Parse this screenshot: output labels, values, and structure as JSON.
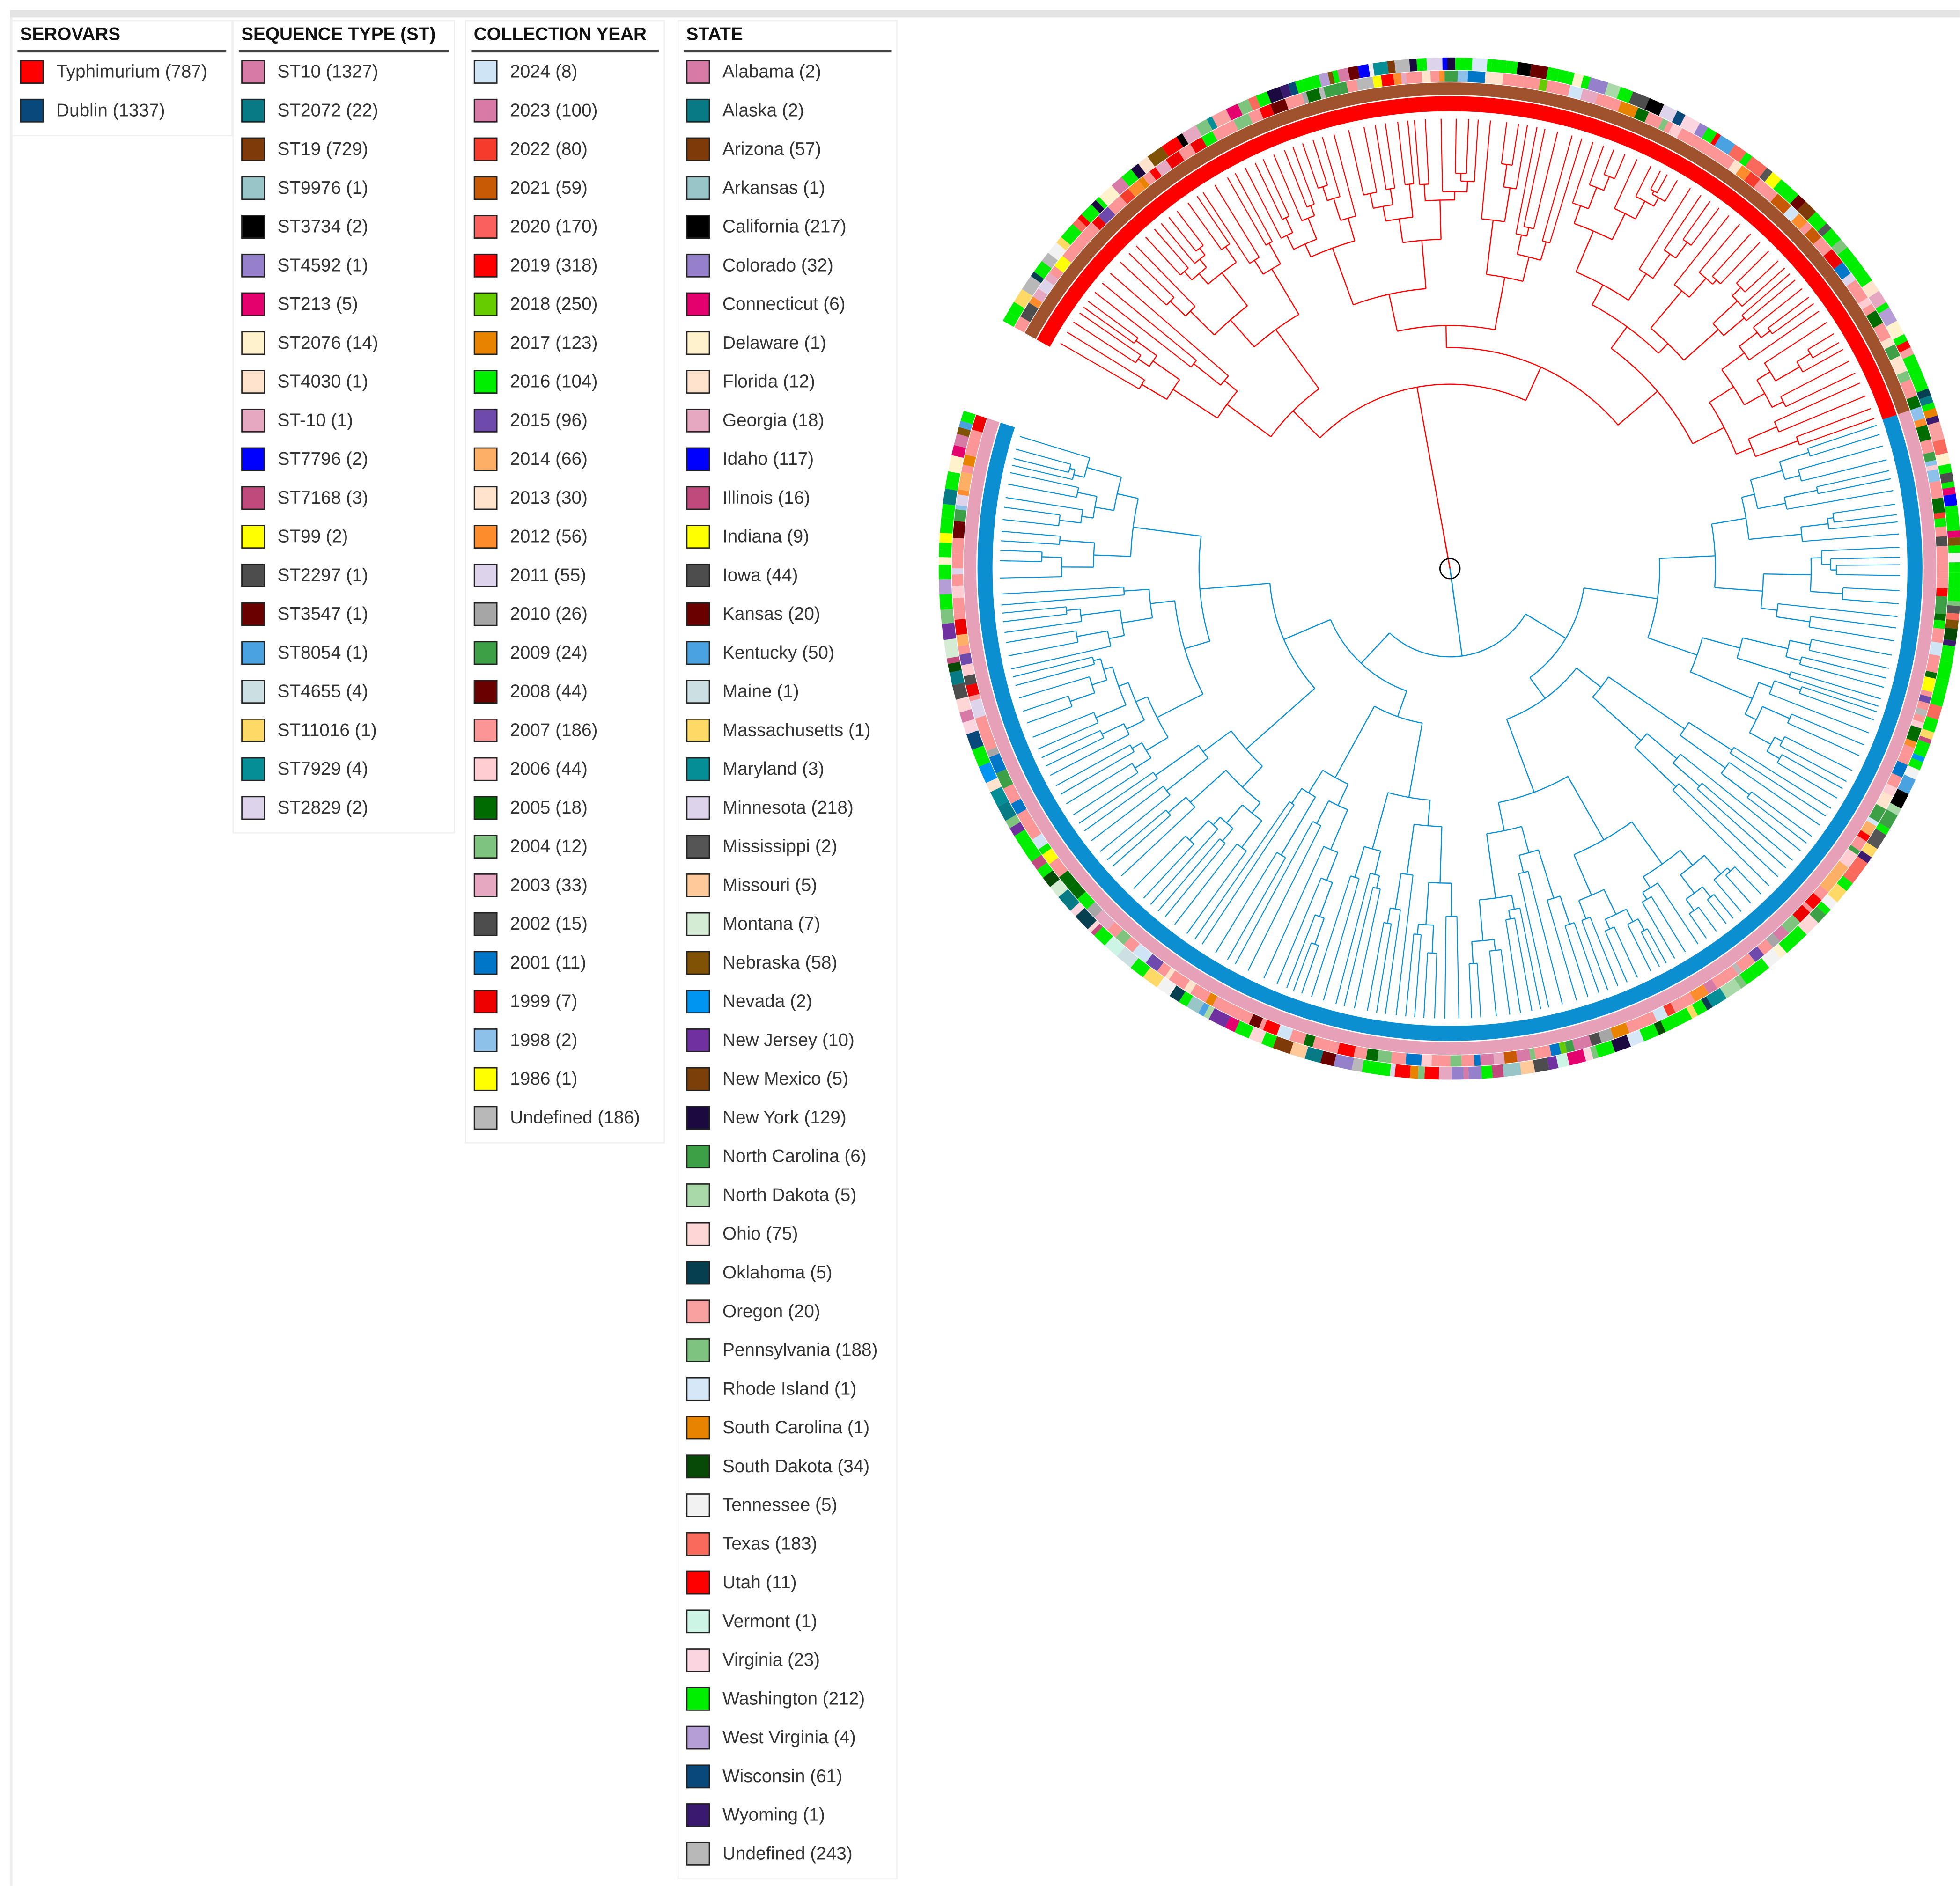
{
  "legends": {
    "serovars": {
      "title": "SEROVARS",
      "items": [
        {
          "label": "Typhimurium (787)",
          "color": "#ff0000"
        },
        {
          "label": "Dublin (1337)",
          "color": "#08487a"
        }
      ]
    },
    "sequence_type": {
      "title": "SEQUENCE TYPE (ST)",
      "items": [
        {
          "label": "ST10 (1327)",
          "color": "#d77aa6"
        },
        {
          "label": "ST2072 (22)",
          "color": "#067b85"
        },
        {
          "label": "ST19 (729)",
          "color": "#7f3a0a"
        },
        {
          "label": "ST9976 (1)",
          "color": "#97c5c8"
        },
        {
          "label": "ST3734 (2)",
          "color": "#000000"
        },
        {
          "label": "ST4592 (1)",
          "color": "#9580cb"
        },
        {
          "label": "ST213 (5)",
          "color": "#e4006d"
        },
        {
          "label": "ST2076 (14)",
          "color": "#fff2cc"
        },
        {
          "label": "ST4030 (1)",
          "color": "#ffe3cc"
        },
        {
          "label": "ST-10 (1)",
          "color": "#e6a7c0"
        },
        {
          "label": "ST7796 (2)",
          "color": "#0000ff"
        },
        {
          "label": "ST7168 (3)",
          "color": "#c04a7c"
        },
        {
          "label": "ST99 (2)",
          "color": "#ffff00"
        },
        {
          "label": "ST2297 (1)",
          "color": "#4d4d4d"
        },
        {
          "label": "ST3547 (1)",
          "color": "#6b0000"
        },
        {
          "label": "ST8054 (1)",
          "color": "#4aa3e0"
        },
        {
          "label": "ST4655 (4)",
          "color": "#cce0e3"
        },
        {
          "label": "ST11016 (1)",
          "color": "#ffd966"
        },
        {
          "label": "ST7929 (4)",
          "color": "#068e96"
        },
        {
          "label": "ST2829 (2)",
          "color": "#ddd3ea"
        }
      ]
    },
    "collection_year": {
      "title": "COLLECTION YEAR",
      "items": [
        {
          "label": "2024 (8)",
          "color": "#cfe4f4"
        },
        {
          "label": "2023 (100)",
          "color": "#d77aa6"
        },
        {
          "label": "2022 (80)",
          "color": "#f53b2b"
        },
        {
          "label": "2021 (59)",
          "color": "#c85a06"
        },
        {
          "label": "2020 (170)",
          "color": "#f9605e"
        },
        {
          "label": "2019 (318)",
          "color": "#ff0000"
        },
        {
          "label": "2018 (250)",
          "color": "#66cc00"
        },
        {
          "label": "2017 (123)",
          "color": "#e88300"
        },
        {
          "label": "2016 (104)",
          "color": "#00ee00"
        },
        {
          "label": "2015 (96)",
          "color": "#6f4aad"
        },
        {
          "label": "2014 (66)",
          "color": "#fdb065"
        },
        {
          "label": "2013 (30)",
          "color": "#ffe3cc"
        },
        {
          "label": "2012 (56)",
          "color": "#fd8c2c"
        },
        {
          "label": "2011 (55)",
          "color": "#ddd3ea"
        },
        {
          "label": "2010 (26)",
          "color": "#a6a6a6"
        },
        {
          "label": "2009 (24)",
          "color": "#3ea046"
        },
        {
          "label": "2008 (44)",
          "color": "#6b0000"
        },
        {
          "label": "2007 (186)",
          "color": "#fc9696"
        },
        {
          "label": "2006 (44)",
          "color": "#ffcdd2"
        },
        {
          "label": "2005 (18)",
          "color": "#006b00"
        },
        {
          "label": "2004 (12)",
          "color": "#7ec47e"
        },
        {
          "label": "2003 (33)",
          "color": "#e6a7c0"
        },
        {
          "label": "2002 (15)",
          "color": "#4d4d4d"
        },
        {
          "label": "2001 (11)",
          "color": "#0076c8"
        },
        {
          "label": "1999 (7)",
          "color": "#ee0000"
        },
        {
          "label": "1998 (2)",
          "color": "#8ec1ea"
        },
        {
          "label": "1986 (1)",
          "color": "#ffff00"
        },
        {
          "label": "Undefined (186)",
          "color": "#b8b8b8"
        }
      ]
    },
    "state": {
      "title": "STATE",
      "items": [
        {
          "label": "Alabama (2)",
          "color": "#d77aa6"
        },
        {
          "label": "Alaska (2)",
          "color": "#067b85"
        },
        {
          "label": "Arizona (57)",
          "color": "#7f3a0a"
        },
        {
          "label": "Arkansas (1)",
          "color": "#97c5c8"
        },
        {
          "label": "California (217)",
          "color": "#000000"
        },
        {
          "label": "Colorado (32)",
          "color": "#9580cb"
        },
        {
          "label": "Connecticut (6)",
          "color": "#e4006d"
        },
        {
          "label": "Delaware (1)",
          "color": "#fff2cc"
        },
        {
          "label": "Florida (12)",
          "color": "#ffe3cc"
        },
        {
          "label": "Georgia (18)",
          "color": "#e6a7c0"
        },
        {
          "label": "Idaho (117)",
          "color": "#0000ff"
        },
        {
          "label": "Illinois (16)",
          "color": "#c04a7c"
        },
        {
          "label": "Indiana (9)",
          "color": "#ffff00"
        },
        {
          "label": "Iowa (44)",
          "color": "#4d4d4d"
        },
        {
          "label": "Kansas (20)",
          "color": "#6b0000"
        },
        {
          "label": "Kentucky (50)",
          "color": "#4aa3e0"
        },
        {
          "label": "Maine (1)",
          "color": "#cce0e3"
        },
        {
          "label": "Massachusetts (1)",
          "color": "#ffd966"
        },
        {
          "label": "Maryland (3)",
          "color": "#068e96"
        },
        {
          "label": "Minnesota (218)",
          "color": "#ddd3ea"
        },
        {
          "label": "Mississippi (2)",
          "color": "#555555"
        },
        {
          "label": "Missouri (5)",
          "color": "#ffc999"
        },
        {
          "label": "Montana (7)",
          "color": "#d4ecd4"
        },
        {
          "label": "Nebraska (58)",
          "color": "#7f5205"
        },
        {
          "label": "Nevada (2)",
          "color": "#0095f0"
        },
        {
          "label": "New Jersey (10)",
          "color": "#7030a0"
        },
        {
          "label": "New Mexico (5)",
          "color": "#7b3f0a"
        },
        {
          "label": "New York (129)",
          "color": "#1a0a40"
        },
        {
          "label": "North Carolina (6)",
          "color": "#3ea046"
        },
        {
          "label": "North Dakota (5)",
          "color": "#a9d9a9"
        },
        {
          "label": "Ohio (75)",
          "color": "#ffd6d6"
        },
        {
          "label": "Oklahoma (5)",
          "color": "#064050"
        },
        {
          "label": "Oregon (20)",
          "color": "#f9a0a0"
        },
        {
          "label": "Pennsylvania (188)",
          "color": "#7ec47e"
        },
        {
          "label": "Rhode Island (1)",
          "color": "#d6e8f7"
        },
        {
          "label": "South Carolina (1)",
          "color": "#e88300"
        },
        {
          "label": "South Dakota (34)",
          "color": "#064a06"
        },
        {
          "label": "Tennessee (5)",
          "color": "#f2f2f2"
        },
        {
          "label": "Texas (183)",
          "color": "#f96a5c"
        },
        {
          "label": "Utah (11)",
          "color": "#ff0000"
        },
        {
          "label": "Vermont (1)",
          "color": "#cdf5e6"
        },
        {
          "label": "Virginia (23)",
          "color": "#fbd6e0"
        },
        {
          "label": "Washington (212)",
          "color": "#00ee00"
        },
        {
          "label": "West Virginia (4)",
          "color": "#b59ed6"
        },
        {
          "label": "Wisconsin (61)",
          "color": "#08487a"
        },
        {
          "label": "Wyoming (1)",
          "color": "#3a1a6e"
        },
        {
          "label": "Undefined (243)",
          "color": "#b8b8b8"
        }
      ]
    }
  },
  "tree": {
    "clades": [
      {
        "serovar": "Typhimurium",
        "color": "#ff0000",
        "st_color": "#a0522d",
        "leaves": 787
      },
      {
        "serovar": "Dublin",
        "color": "#0b8fd1",
        "st_color": "#e6a0b8",
        "leaves": 1337
      }
    ]
  }
}
